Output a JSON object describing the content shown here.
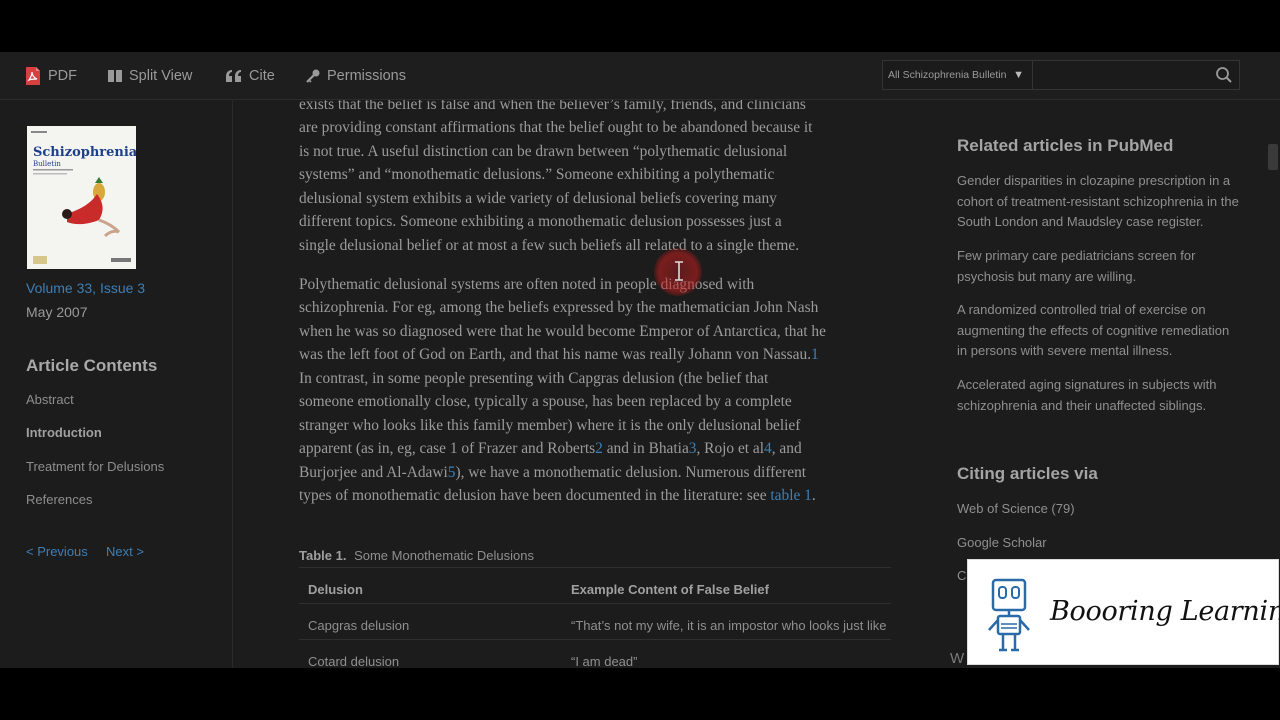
{
  "toolbar": {
    "pdf_label": "PDF",
    "split_view_label": "Split View",
    "cite_label": "Cite",
    "permissions_label": "Permissions",
    "search_scope": "All Schizophrenia Bulletin",
    "search_placeholder": ""
  },
  "sidebar": {
    "cover_title": "Schizophrenia",
    "cover_subtitle": "Bulletin",
    "issue_link": "Volume 33, Issue 3",
    "issue_date": "May 2007",
    "contents_heading": "Article Contents",
    "toc": [
      "Abstract",
      "Introduction",
      "Treatment for Delusions",
      "References"
    ],
    "prev": "< Previous",
    "next": "Next >"
  },
  "article": {
    "p1_lines": [
      "exists that the belief is false and when the believer’s family, friends, and clinicians",
      "are providing constant affirmations that the belief ought to be abandoned because it",
      "is not true. A useful distinction can be drawn between “polythematic delusional",
      "systems” and “monothematic delusions.” Someone exhibiting a polythematic",
      "delusional system exhibits a wide variety of delusional beliefs covering many",
      "different topics. Someone exhibiting a monothematic delusion possesses just a",
      "single delusional belief or at most a few such beliefs all related to a single theme."
    ],
    "p2": {
      "l1": "Polythematic delusional systems are often noted in people diagnosed with",
      "l2": "schizophrenia. For eg, among the beliefs expressed by the mathematician John Nash",
      "l3": "when he was so diagnosed were that he would become Emperor of Antarctica, that he",
      "l4": "was the left foot of God on Earth, and that his name was really Johann von Nassau.",
      "l4_ref": "1",
      "l5": "In contrast, in some people presenting with Capgras delusion (the belief that",
      "l6": "someone emotionally close, typically a spouse, has been replaced by a complete",
      "l7": "stranger who looks like this family member) where it is the only delusional belief",
      "l8a": "apparent (as in, eg, case 1 of Frazer and Roberts",
      "l8_ref1": "2",
      "l8b": " and in Bhatia",
      "l8_ref2": "3",
      "l8c": ", Rojo et al",
      "l8_ref3": "4",
      "l8d": ", and",
      "l9a": "Burjorjee and Al-Adawi",
      "l9_ref": "5",
      "l9b": "), we have a monothematic delusion. Numerous different",
      "l10a": "types of monothematic delusion have been documented in the literature: see ",
      "l10_link": "table 1",
      "l10b": "."
    },
    "table": {
      "caption_label": "Table 1.",
      "caption_text": "Some Monothematic Delusions",
      "headers": [
        "Delusion",
        "Example Content of False Belief"
      ],
      "rows": [
        [
          "Capgras delusion",
          "“That’s not my wife, it is an impostor who looks just like"
        ],
        [
          "Cotard delusion",
          "“I am dead”"
        ]
      ]
    }
  },
  "right": {
    "related_heading": "Related articles in PubMed",
    "related": [
      "Gender disparities in clozapine prescription in a cohort of treatment-resistant schizophrenia in the South London and Maudsley case register.",
      "Few primary care pediatricians screen for psychosis but many are willing.",
      "A randomized controlled trial of exercise on augmenting the effects of cognitive remediation in persons with severe mental illness.",
      "Accelerated aging signatures in subjects with schizophrenia and their unaffected siblings."
    ],
    "citing_heading": "Citing articles via",
    "citing": [
      "Web of Science (79)",
      "Google Scholar",
      "Cr"
    ],
    "partial_lines": [
      "W",
      "Wi",
      "L"
    ]
  },
  "watermark": {
    "text": "Boooring Learning"
  },
  "colors": {
    "link": "#3d7fb6",
    "background": "#1c1c1c",
    "cursor_highlight": "#c81e1e"
  }
}
